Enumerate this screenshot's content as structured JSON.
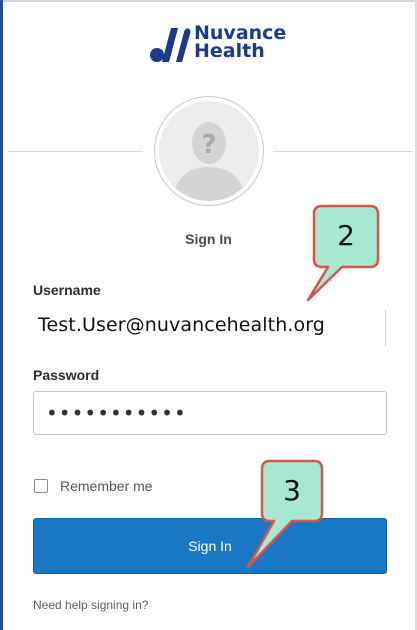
{
  "brand": {
    "line1": "Nuvance",
    "line2": "Health",
    "colors": {
      "navy": "#1c3a8a",
      "button_blue": "#1878c4",
      "callout_fill": "#a6e8d0",
      "callout_border": "#d9534f"
    }
  },
  "login": {
    "title": "Sign In",
    "username_label": "Username",
    "username_value": "Test.User@nuvancehealth.org",
    "password_label": "Password",
    "password_value": "•••••••••••",
    "remember_label": "Remember me",
    "submit_label": "Sign In",
    "help_link": "Need help signing in?"
  },
  "callouts": [
    {
      "number": "2"
    },
    {
      "number": "3"
    }
  ],
  "icons": [
    "nuvance-logo-icon",
    "avatar-placeholder-icon",
    "checkbox-icon"
  ]
}
